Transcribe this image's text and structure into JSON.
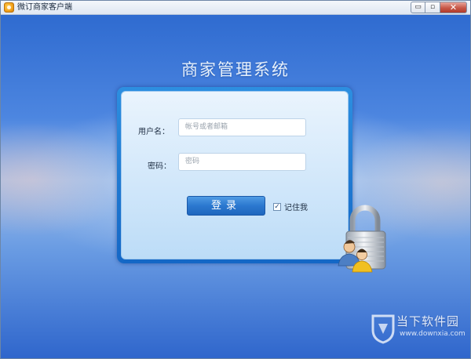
{
  "window": {
    "title": "微订商家客户端",
    "controls": {
      "minimize": "▭",
      "maximize": "▫",
      "close": "✕"
    }
  },
  "login": {
    "system_title": "商家管理系统",
    "username_label": "用户名：",
    "username_placeholder": "帐号或者邮箱",
    "password_label": "密码：",
    "password_placeholder": "密码",
    "submit_label": "登录",
    "remember_label": "记住我",
    "remember_checked": true
  },
  "watermark": {
    "brand": "当下软件园",
    "url": "www.downxia.com"
  },
  "colors": {
    "panel_border": "#1467c6",
    "button": "#2b78cf",
    "background_blue": "#2f6bd0"
  },
  "icons": {
    "app": "app-logo-icon",
    "lock": "padlock-users-icon",
    "watermark_logo": "downxia-logo-icon"
  }
}
